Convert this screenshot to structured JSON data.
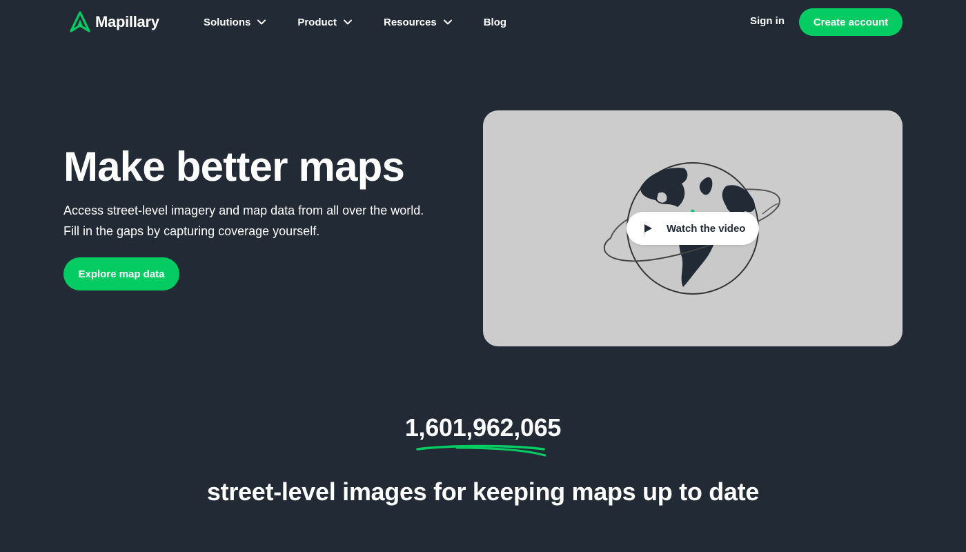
{
  "brand": {
    "name": "Mapillary",
    "accent_color": "#05cb63",
    "background_color": "#212a35"
  },
  "nav": {
    "items": [
      {
        "label": "Solutions",
        "has_dropdown": true
      },
      {
        "label": "Product",
        "has_dropdown": true
      },
      {
        "label": "Resources",
        "has_dropdown": true
      },
      {
        "label": "Blog",
        "has_dropdown": false
      }
    ],
    "sign_in_label": "Sign in",
    "create_account_label": "Create account"
  },
  "hero": {
    "title": "Make better maps",
    "subtitle_line1": "Access street-level imagery and map data from all over the world.",
    "subtitle_line2": "Fill in the gaps by capturing coverage yourself.",
    "cta_label": "Explore map data"
  },
  "video": {
    "watch_label": "Watch the video",
    "icon": "play-icon",
    "illustration": "globe-with-orbit"
  },
  "stats": {
    "image_count": "1,601,962,065",
    "caption": "street-level images for keeping maps up to date"
  }
}
